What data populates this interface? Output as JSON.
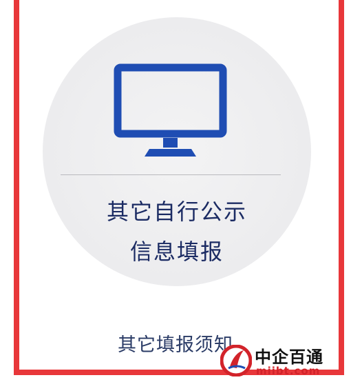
{
  "card": {
    "title_line1": "其它自行公示",
    "title_line2": "信息填报",
    "icon": "monitor-icon"
  },
  "notice": {
    "label": "其它填报须知"
  },
  "watermark": {
    "name": "中企百通",
    "url": "miibt.com"
  },
  "colors": {
    "frame": "#e8373a",
    "icon": "#1f4db3",
    "title": "#1b2b63"
  }
}
